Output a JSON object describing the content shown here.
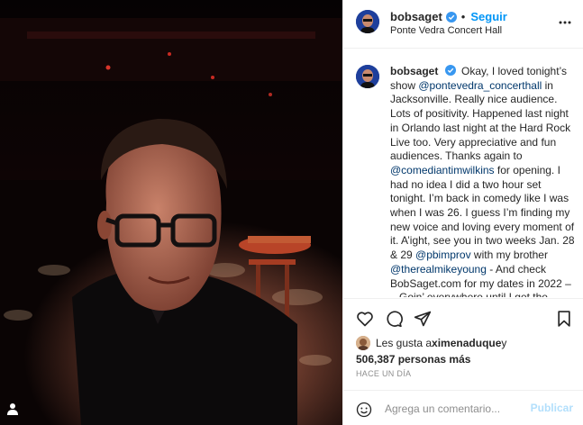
{
  "post": {
    "username": "bobsaget",
    "follow_label": "Seguir",
    "location": "Ponte Vedra Concert Hall",
    "caption_parts": [
      "Okay, I loved tonight’s show ",
      "@pontevedra_concerthall",
      " in Jacksonville. Really nice audience. Lots of positivity. Happened last night in Orlando last night at the Hard Rock Live too. Very appreciative and fun audiences. Thanks again to ",
      "@comediantimwilkins",
      " for opening. I had no idea I did a two hour set tonight. I’m back in comedy like I was when I was 26. I guess I’m finding my new voice and loving every moment of it. A’ight, see you in two weeks Jan. 28 & 29 ",
      "@pbimprov",
      " with my brother ",
      "@therealmikeyoung",
      " - And check BobSaget.com for my dates in 2022 – – Goin’ everywhere until I get the special shot. And then probably keep going"
    ],
    "likes_prefix": "Les gusta a ",
    "liker": "ximenaduque",
    "likes_connector": " y",
    "likes_count_text": "506,387 personas más",
    "timestamp": "HACE UN DÍA",
    "comment_placeholder": "Agrega un comentario...",
    "post_label": "Publicar"
  },
  "colors": {
    "accent": "#0095f6",
    "verified": "#3897f0",
    "text": "#262626",
    "muted": "#8e8e8e"
  },
  "icons": [
    "verified-badge-icon",
    "more-options-icon",
    "heart-icon",
    "comment-icon",
    "share-icon",
    "bookmark-icon",
    "emoji-icon",
    "user-tag-icon"
  ]
}
